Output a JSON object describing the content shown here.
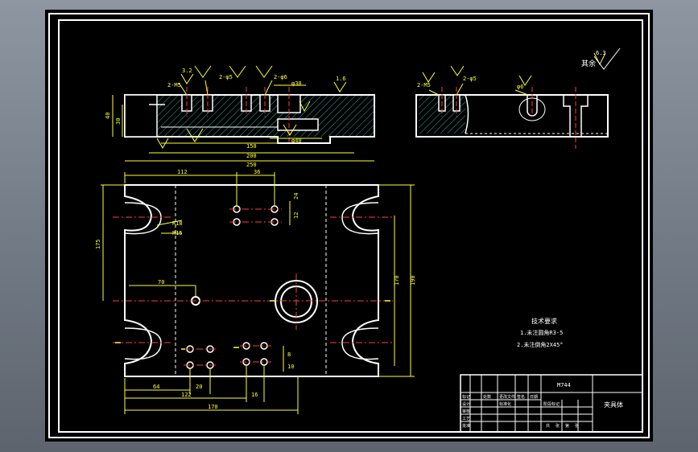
{
  "drawing": {
    "title_block": {
      "drawing_number": "M744",
      "part_name": "夹具体",
      "cells": [
        "标记",
        "处数",
        "更改文件",
        "签名",
        "日期",
        "设计",
        "标准化",
        "阶段标记",
        "审核",
        "工艺",
        "批准",
        "共",
        "张",
        "第",
        "张"
      ]
    },
    "tech_requirements": {
      "heading": "技术要求",
      "items": [
        "1.未注圆角R3-5",
        "2.未注倒角2X45°"
      ]
    },
    "surface_roughness": {
      "rest_label": "其余",
      "value": "6.3"
    },
    "front_view_dims": {
      "holes_left": "2-M5",
      "holes_mid": "2-φ5",
      "holes_right": "2-φ6",
      "hole_center": "φ30",
      "hole_bottom": "φ40",
      "height_40": "40",
      "height_30": "30",
      "len_150": "150",
      "len_200": "200",
      "len_250": "250",
      "roughness_1": "3.2",
      "roughness_2": "1.6"
    },
    "side_view_dims": {
      "holes_left": "2-M5",
      "holes_mid": "2-φ5",
      "hole_right": "φ6"
    },
    "plan_view_dims": {
      "top_112": "112",
      "top_36": "36",
      "dim_24": "24",
      "dim_12": "12",
      "left_175": "175",
      "r_18": "R18",
      "r_15": "R15",
      "dim_70": "70",
      "right_170": "170",
      "right_190": "190",
      "bottom_64": "64",
      "bottom_20": "20",
      "bottom_122": "122",
      "bottom_16": "16",
      "bottom_170": "170",
      "small_8": "8",
      "small_10": "10"
    }
  }
}
